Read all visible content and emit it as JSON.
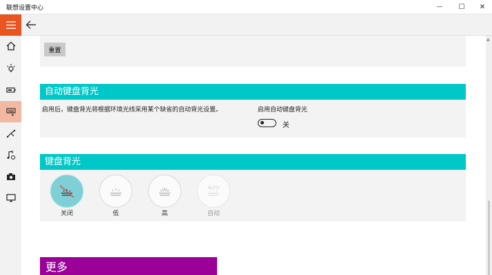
{
  "window": {
    "title": "联想设置中心",
    "minimize": "—",
    "maximize": "☐",
    "close": "✕"
  },
  "sidebar": {
    "items": [
      {
        "icon": "home-icon"
      },
      {
        "icon": "lightbulb-icon"
      },
      {
        "icon": "battery-icon"
      },
      {
        "icon": "keyboard-icon",
        "active": true
      },
      {
        "icon": "network-icon"
      },
      {
        "icon": "audio-icon"
      },
      {
        "icon": "camera-icon"
      },
      {
        "icon": "display-icon"
      }
    ]
  },
  "top_section": {
    "reset_label": "重置"
  },
  "auto_backlight": {
    "header": "自动键盘背光",
    "description": "启用后，键盘背光将根据环境光线采用某个缺省的自动背光设置。",
    "toggle_label": "启用自动键盘背光",
    "toggle_state": "关",
    "toggle_on": false
  },
  "backlight": {
    "header": "键盘背光",
    "levels": [
      {
        "label": "关闭",
        "selected": true,
        "icon": "backlight-off-icon"
      },
      {
        "label": "低",
        "selected": false,
        "icon": "backlight-low-icon"
      },
      {
        "label": "高",
        "selected": false,
        "icon": "backlight-high-icon"
      },
      {
        "label": "自动",
        "selected": false,
        "disabled": true,
        "icon": "backlight-auto-icon",
        "icon_text": "AUTO"
      }
    ]
  },
  "more": {
    "header": "更多"
  },
  "colors": {
    "accent_orange": "#e95420",
    "section_teal": "#00c8c8",
    "more_purple": "#9b0098",
    "active_nav": "#f2b8a2"
  }
}
